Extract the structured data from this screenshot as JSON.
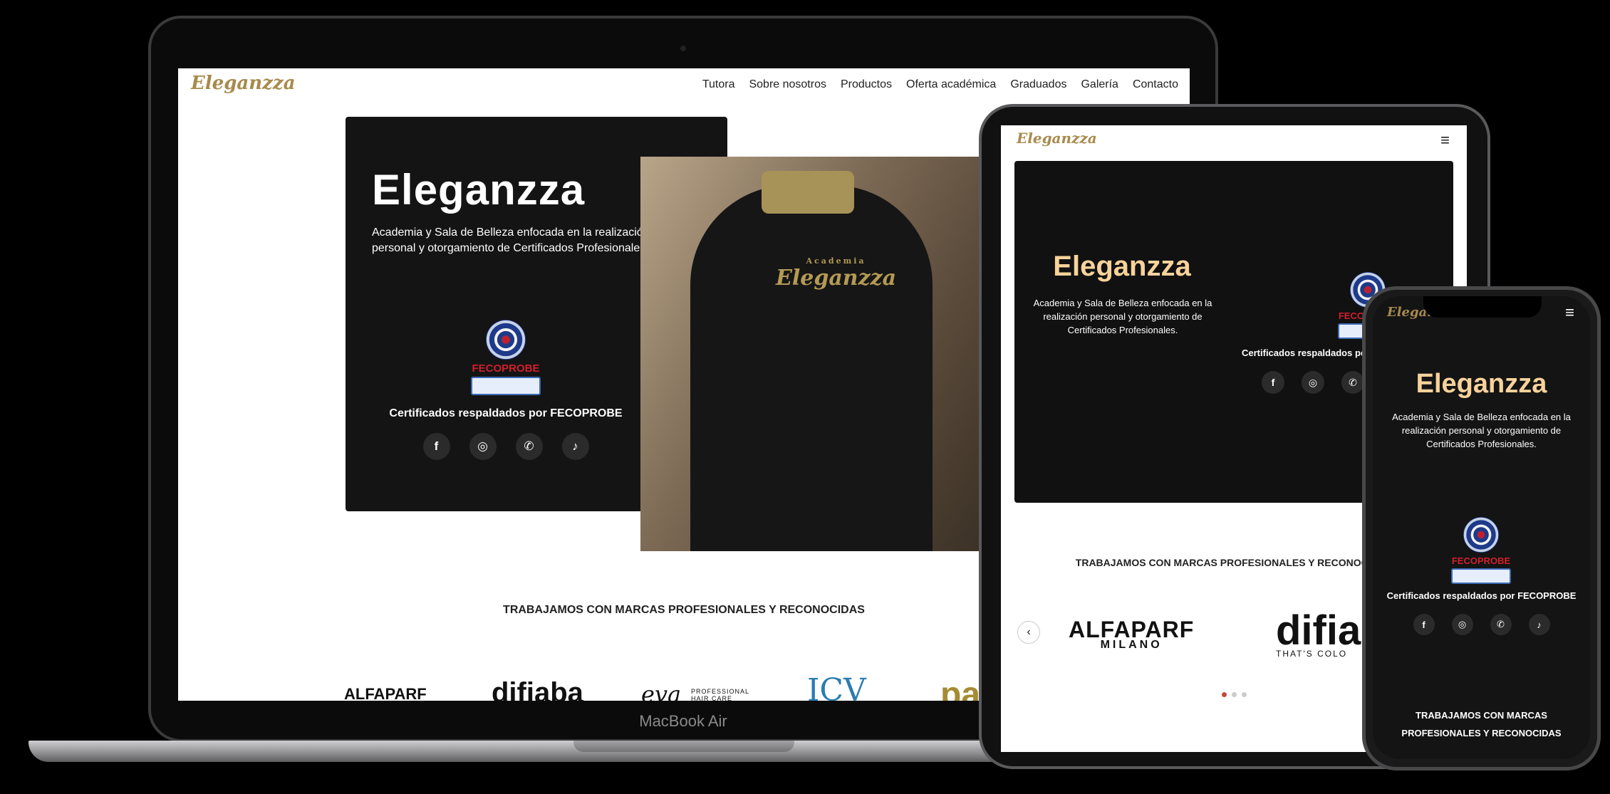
{
  "brand": {
    "name": "Eleganzza"
  },
  "nav": {
    "items": [
      "Tutora",
      "Sobre nosotros",
      "Productos",
      "Oferta académica",
      "Graduados",
      "Galería",
      "Contacto"
    ]
  },
  "hero": {
    "title": "Eleganzza",
    "description": "Academia y Sala de Belleza enfocada en la realización personal y otorgamiento de Certificados Profesionales.",
    "fecoprobe_label": "FECOPROBE",
    "certified_text": "Certificados respaldados por FECOPROBE",
    "shirt_logo": "Eleganzza",
    "shirt_logo_sub": "Academia"
  },
  "socials": [
    {
      "name": "facebook-icon",
      "glyph": "f"
    },
    {
      "name": "instagram-icon",
      "glyph": "◎"
    },
    {
      "name": "whatsapp-icon",
      "glyph": "✆"
    },
    {
      "name": "tiktok-icon",
      "glyph": "♪"
    }
  ],
  "brands": {
    "title": "TRABAJAMOS CON MARCAS PROFESIONALES Y RECONOCIDAS",
    "items": [
      "ALFAPARF",
      "MILANO",
      "difiaba",
      "eva",
      "PROFESSIONAL HAIR CARE",
      "ICV",
      "pa"
    ]
  },
  "tablet": {
    "menu_glyph": "≡",
    "prev_arrow": "‹",
    "brand1": "ALFAPARF",
    "brand1_sub": "MILANO",
    "brand2": "difial",
    "brand2_sub": "THAT'S COLO"
  },
  "device_label": "MacBook Air",
  "colors": {
    "accent_gold": "#f7d29a",
    "logo_gold": "#a88a4c",
    "fecoprobe_red": "#d11f2a",
    "dark_bg": "#141414"
  }
}
